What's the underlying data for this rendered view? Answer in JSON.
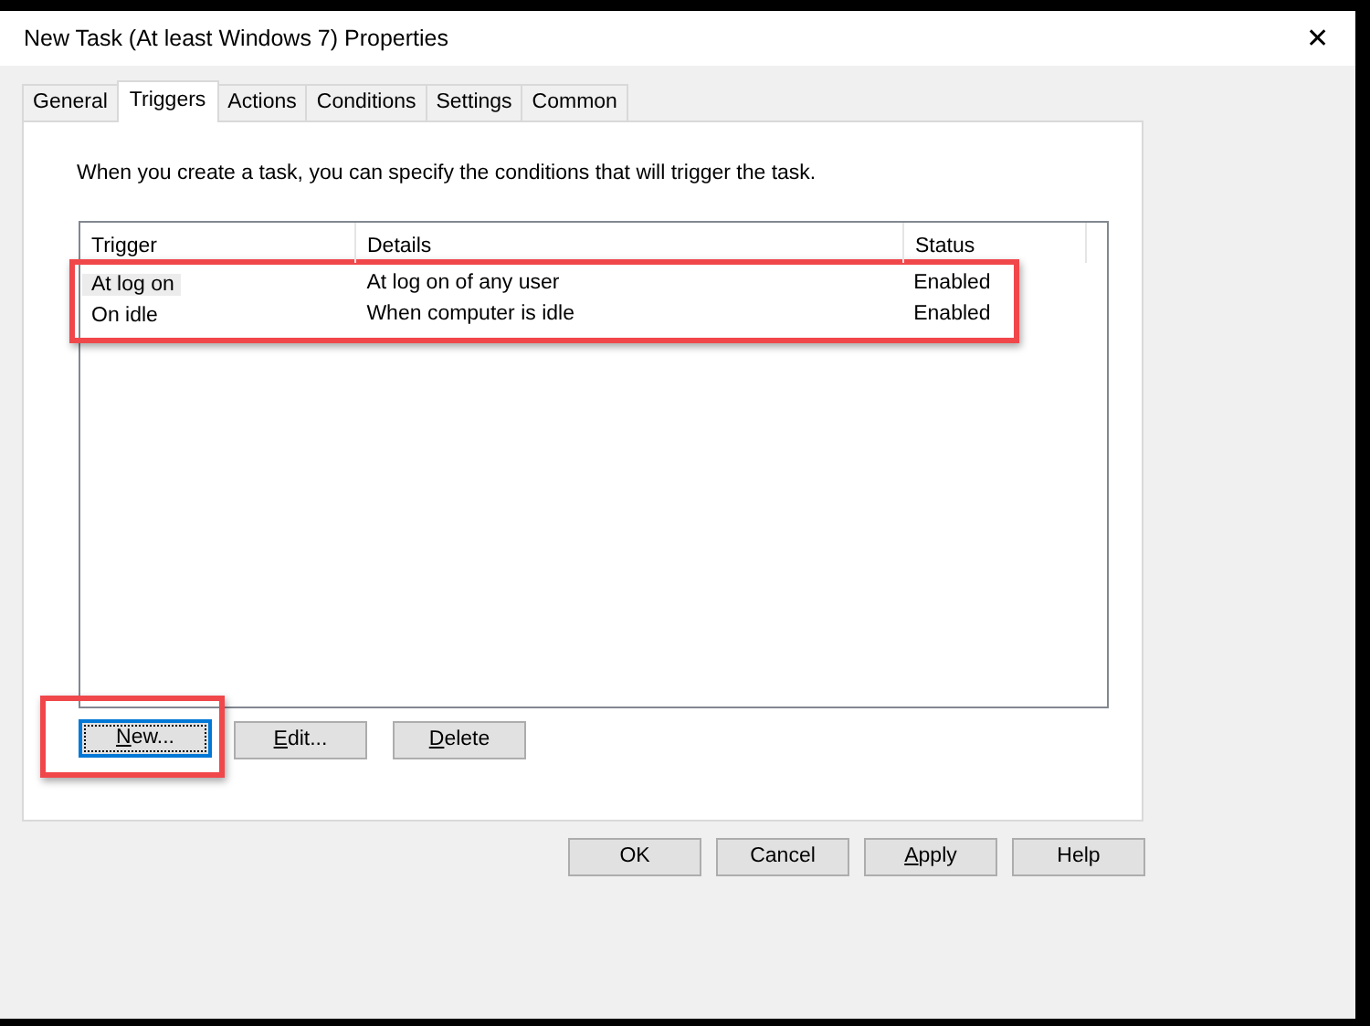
{
  "window": {
    "title": "New Task (At least Windows 7) Properties",
    "close": "✕"
  },
  "tabs": [
    {
      "label": "General",
      "selected": false
    },
    {
      "label": "Triggers",
      "selected": true
    },
    {
      "label": "Actions",
      "selected": false
    },
    {
      "label": "Conditions",
      "selected": false
    },
    {
      "label": "Settings",
      "selected": false
    },
    {
      "label": "Common",
      "selected": false
    }
  ],
  "description": "When you create a task, you can specify the conditions that will trigger the task.",
  "table": {
    "columns": [
      "Trigger",
      "Details",
      "Status"
    ],
    "rows_highlighted": true,
    "rows": [
      {
        "cells": [
          "At log on",
          "At log on of any user",
          "Enabled"
        ],
        "selected": true
      },
      {
        "cells": [
          "On idle",
          "When computer is idle",
          "Enabled"
        ],
        "selected": false
      }
    ]
  },
  "list_buttons": [
    {
      "label": "New...",
      "mnemonic": true,
      "focused": true,
      "highlighted": true
    },
    {
      "label": "Edit...",
      "mnemonic": true,
      "focused": false,
      "highlighted": false
    },
    {
      "label": "Delete",
      "mnemonic": true,
      "focused": false,
      "highlighted": false
    }
  ],
  "dialog_buttons": [
    {
      "label": "OK",
      "mnemonic": false
    },
    {
      "label": "Cancel",
      "mnemonic": false
    },
    {
      "label": "Apply",
      "mnemonic": true
    },
    {
      "label": "Help",
      "mnemonic": false
    }
  ]
}
